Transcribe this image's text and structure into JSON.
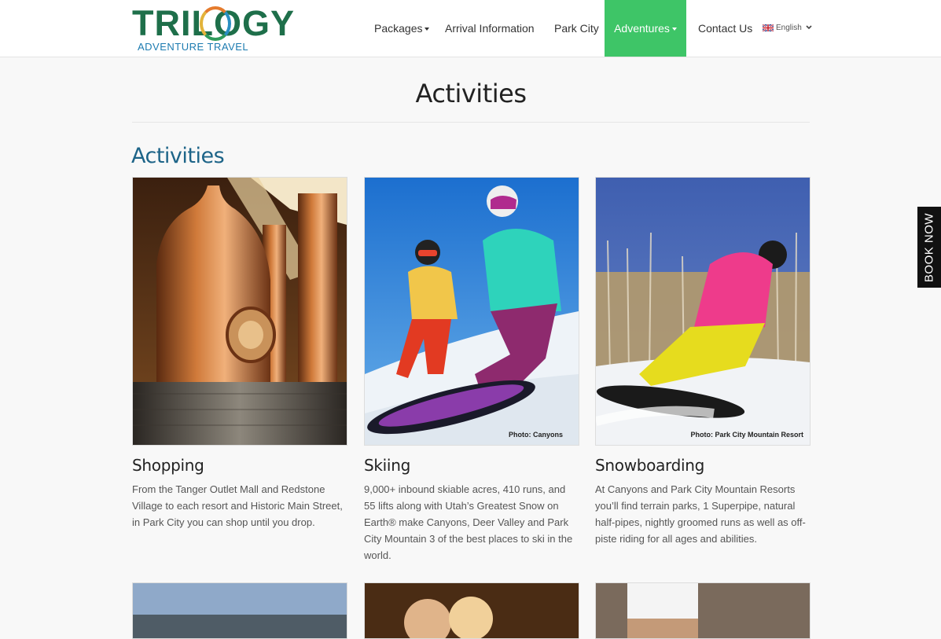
{
  "logo": {
    "title": "TRILOGY",
    "subtitle": "ADVENTURE TRAVEL"
  },
  "nav": {
    "items": [
      {
        "label": "Packages"
      },
      {
        "label": "Arrival Information"
      },
      {
        "label": "Park City"
      },
      {
        "label": "Adventures"
      },
      {
        "label": "Contact Us"
      }
    ],
    "language": "English",
    "active_color": "#3ec567"
  },
  "page": {
    "title": "Activities",
    "section_title": "Activities"
  },
  "cards": [
    {
      "title": "Shopping",
      "description": "From the Tanger Outlet Mall and Redstone Village to each resort and Historic Main Street, in Park City you can shop until you drop.",
      "photo_credit": ""
    },
    {
      "title": "Skiing",
      "description": "9,000+ inbound skiable acres, 410 runs, and 55 lifts along with Utah’s Greatest Snow on Earth® make Canyons, Deer Valley and Park City Mountain 3 of the best places to ski in the world.",
      "photo_credit": "Photo: Canyons"
    },
    {
      "title": "Snowboarding",
      "description": "At Canyons and Park City Mountain Resorts you’ll find terrain parks, 1 Superpipe, natural half-pipes, nightly groomed runs as well as off-piste riding for all ages and abilities.",
      "photo_credit": "Photo: Park City Mountain Resort"
    }
  ],
  "book_now": "BOOK NOW",
  "colors": {
    "brand_green": "#1e6f4a",
    "section_blue": "#1d6488",
    "book_now_bg": "#111111"
  }
}
